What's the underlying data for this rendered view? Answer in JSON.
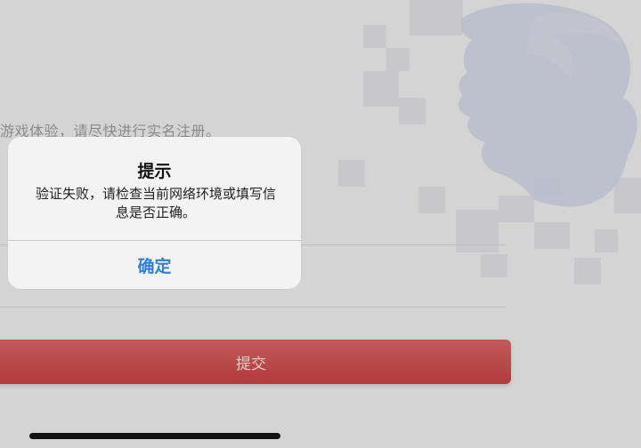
{
  "background": {
    "notice_text": "游戏体验，请尽快进行实名注册。",
    "submit_label": "提交"
  },
  "alert": {
    "title": "提示",
    "message": "验证失败，请检查当前网络环境或填写信息是否正确。",
    "confirm_label": "确定"
  },
  "colors": {
    "confirm_blue": "#2f7fd8",
    "submit_red": "#b23a3a",
    "dim_background": "#d4d4d4"
  }
}
